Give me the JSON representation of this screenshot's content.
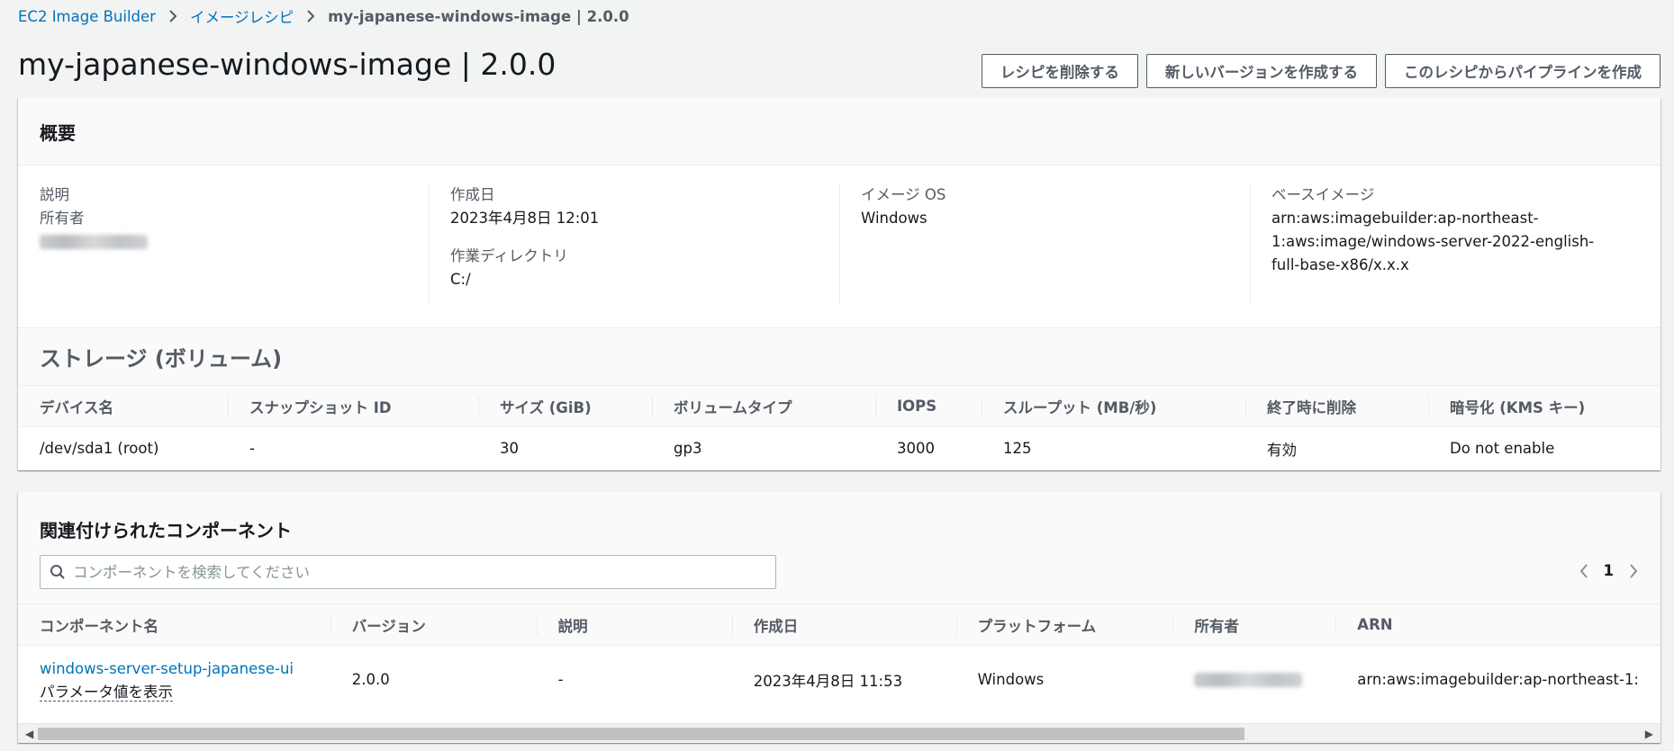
{
  "breadcrumb": {
    "items": [
      "EC2 Image Builder",
      "イメージレシピ"
    ],
    "current": "my-japanese-windows-image | 2.0.0"
  },
  "page": {
    "title": "my-japanese-windows-image | 2.0.0"
  },
  "actions": {
    "delete": "レシピを削除する",
    "new_version": "新しいバージョンを作成する",
    "create_pipeline": "このレシピからパイプラインを作成"
  },
  "summary": {
    "title": "概要",
    "description_label": "説明",
    "description_value": "",
    "owner_label": "所有者",
    "created_label": "作成日",
    "created_value": "2023年4月8日 12:01",
    "workdir_label": "作業ディレクトリ",
    "workdir_value": "C:/",
    "os_label": "イメージ OS",
    "os_value": "Windows",
    "base_label": "ベースイメージ",
    "base_value": "arn:aws:imagebuilder:ap-northeast-1:aws:image/windows-server-2022-english-full-base-x86/x.x.x"
  },
  "storage": {
    "title": "ストレージ (ボリューム)",
    "columns": [
      "デバイス名",
      "スナップショット ID",
      "サイズ (GiB)",
      "ボリュームタイプ",
      "IOPS",
      "スループット (MB/秒)",
      "終了時に削除",
      "暗号化 (KMS キー)"
    ],
    "row": [
      "/dev/sda1 (root)",
      "-",
      "30",
      "gp3",
      "3000",
      "125",
      "有効",
      "Do not enable"
    ]
  },
  "components": {
    "title": "関連付けられたコンポーネント",
    "search_placeholder": "コンポーネントを検索してください",
    "page": "1",
    "columns": [
      "コンポーネント名",
      "バージョン",
      "説明",
      "作成日",
      "プラットフォーム",
      "所有者",
      "ARN"
    ],
    "row": {
      "name": "windows-server-setup-japanese-ui",
      "param_link": "パラメータ値を表示",
      "version": "2.0.0",
      "description": "-",
      "created": "2023年4月8日 11:53",
      "platform": "Windows",
      "arn": "arn:aws:imagebuilder:ap-northeast-1:"
    }
  }
}
